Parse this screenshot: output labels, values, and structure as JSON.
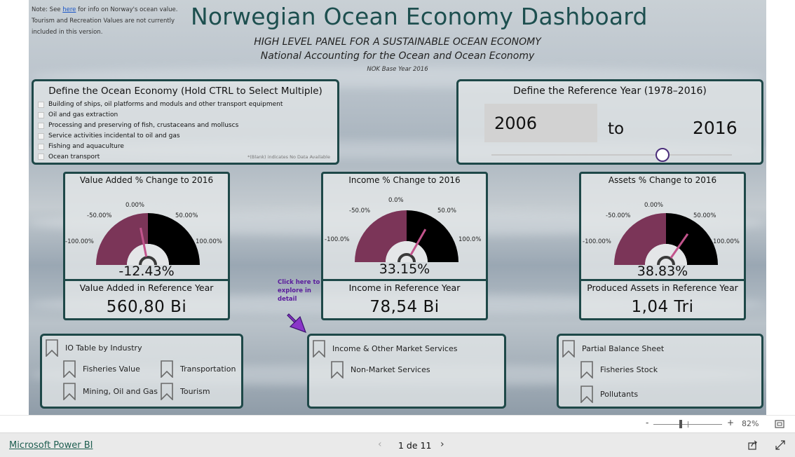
{
  "note": {
    "prefix": "Note: See ",
    "link": "here",
    "suffix": " for info on Norway's ocean value. Tourism and Recreation Values are not currently included in this version."
  },
  "header": {
    "title": "Norwegian Ocean Economy Dashboard",
    "subtitle1": "HIGH LEVEL PANEL FOR A SUSTAINABLE OCEAN ECONOMY",
    "subtitle2": "National Accounting for the Ocean and Ocean Economy",
    "base_year": "NOK Base Year 2016"
  },
  "filter": {
    "title": "Define the Ocean Economy (Hold CTRL to Select Multiple)",
    "items": [
      "Building of ships, oil platforms and moduls and other transport equipment",
      "Oil and gas extraction",
      "Processing and preserving of fish, crustaceans and molluscs",
      "Service activities incidental to oil and gas",
      "Fishing and aquaculture",
      "Ocean transport"
    ],
    "footnote": "*(Blank) indicates No Data Available"
  },
  "reference_year": {
    "title": "Define the Reference Year (1978–2016)",
    "from": "2006",
    "to_label": "to",
    "to": "2016",
    "slider_position": 0.71
  },
  "gauges": [
    {
      "title": "Value Added % Change to 2016",
      "labels": {
        "zero": "0.00%",
        "neg50": "-50.00%",
        "pos50": "50.00%",
        "neg100": "-100.00%",
        "pos100": "100.00%"
      },
      "value": "-12.43%",
      "fraction": -0.1243,
      "ref_label": "Value Added in Reference Year",
      "ref_value": "560,80 Bi"
    },
    {
      "title": "Income % Change to 2016",
      "labels": {
        "zero": "0.0%",
        "neg50": "-50.0%",
        "pos50": "50.0%",
        "neg100": "-100.0%",
        "pos100": "100.0%"
      },
      "value": "33.15%",
      "fraction": 0.3315,
      "ref_label": "Income in Reference Year",
      "ref_value": "78,54 Bi"
    },
    {
      "title": "Assets % Change to 2016",
      "labels": {
        "zero": "0.00%",
        "neg50": "-50.00%",
        "pos50": "50.00%",
        "neg100": "-100.00%",
        "pos100": "100.00%"
      },
      "value": "38.83%",
      "fraction": 0.3883,
      "ref_label": "Produced Assets in Reference Year",
      "ref_value": "1,04 Tri"
    }
  ],
  "colors": {
    "gauge_negative": "#7b3558",
    "gauge_positive": "#000000",
    "needle": "#c2548c",
    "panel_border": "#1e4848",
    "title": "#1d4f4f",
    "callout": "#5a1c9c",
    "arrow": "#8a35c8"
  },
  "callout": {
    "text": "Click here to explore in detail",
    "icon": "arrow-icon"
  },
  "nav": {
    "io_group": {
      "title": "IO Table by Industry",
      "items": [
        "Fisheries Value",
        "Transportation",
        "Mining, Oil and Gas",
        "Tourism"
      ]
    },
    "income_group": {
      "title": "Income & Other Market Services",
      "items": [
        "Non-Market Services"
      ]
    },
    "balance_group": {
      "title": "Partial Balance Sheet",
      "items": [
        "Fisheries Stock",
        "Pollutants"
      ]
    }
  },
  "statusbar": {
    "zoom_minus": "-",
    "zoom_plus": "+",
    "zoom": "82%",
    "zoom_fraction": 0.4
  },
  "footer": {
    "brand": "Microsoft Power BI",
    "page": "1 de 11"
  }
}
